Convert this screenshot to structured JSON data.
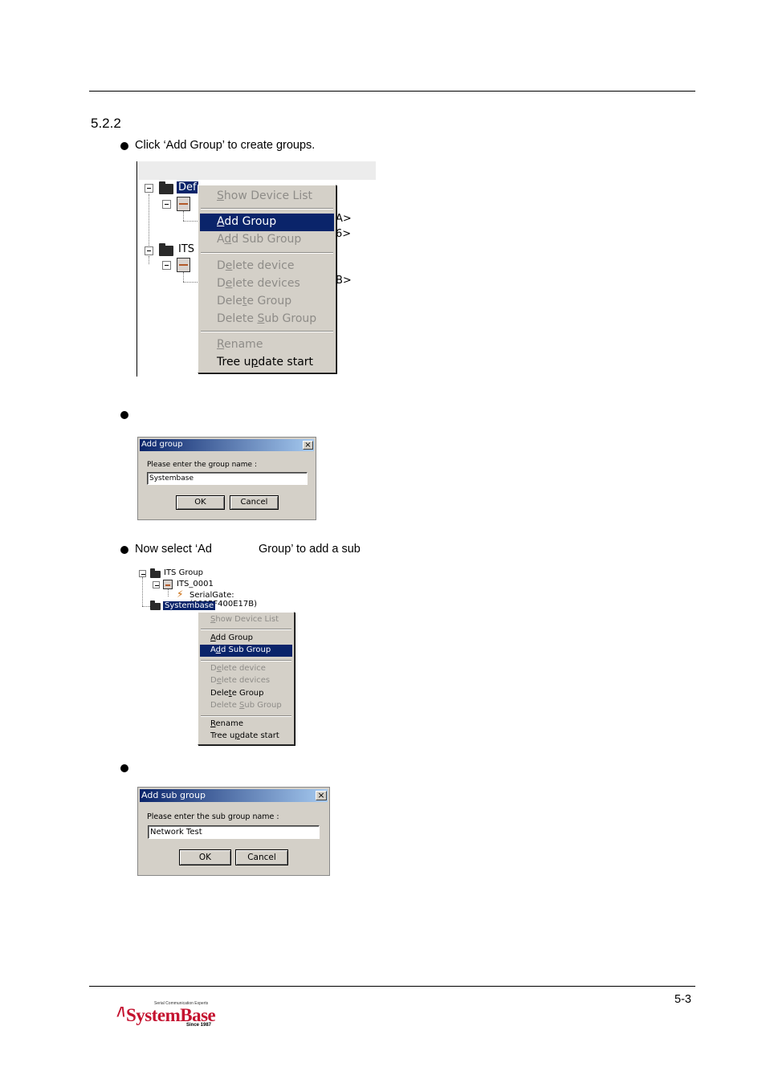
{
  "section": {
    "number": "5.2.2"
  },
  "bullets": {
    "b1": "Click ‘Add Group’ to create groups.",
    "b3_part1": "Now select ‘Ad",
    "b3_part2": "Group’ to add a sub"
  },
  "shot1": {
    "tree": {
      "root1_label": "Def",
      "root2_label": "ITS",
      "suffix1": "A>",
      "suffix2": "6>",
      "suffix3": "B>"
    },
    "menu": {
      "show_device_list": [
        "S",
        "how Device List"
      ],
      "add_group": [
        "A",
        "dd Group"
      ],
      "add_sub_group": [
        "A",
        "d",
        "d Sub Group"
      ],
      "delete_device": [
        "D",
        "e",
        "lete device"
      ],
      "delete_devices": [
        "D",
        "e",
        "lete devices"
      ],
      "delete_group": [
        "Dele",
        "t",
        "e Group"
      ],
      "delete_sub_group": [
        "Delete ",
        "S",
        "ub Group"
      ],
      "rename": [
        "R",
        "ename"
      ],
      "tree_update_start": [
        "Tree u",
        "p",
        "date start"
      ]
    }
  },
  "dialog1": {
    "title": "Add group",
    "close": "×",
    "prompt": "Please enter the group name :",
    "value": "Systembase",
    "ok": "OK",
    "cancel": "Cancel"
  },
  "shot3": {
    "tree": {
      "group_label": "ITS Group",
      "device_label": "ITS_0001",
      "port_label": "SerialGate:(0005F400E17B)",
      "selected_label": "Systembase"
    },
    "menu": {
      "show_device_list": [
        "S",
        "how Device List"
      ],
      "add_group": [
        "A",
        "dd Group"
      ],
      "add_sub_group": [
        "A",
        "d",
        "d Sub Group"
      ],
      "delete_device": [
        "D",
        "e",
        "lete device"
      ],
      "delete_devices": [
        "D",
        "e",
        "lete devices"
      ],
      "delete_group": [
        "Dele",
        "t",
        "e Group"
      ],
      "delete_sub_group": [
        "Delete ",
        "S",
        "ub Group"
      ],
      "rename": [
        "R",
        "ename"
      ],
      "tree_update_start": [
        "Tree u",
        "p",
        "date start"
      ]
    }
  },
  "dialog2": {
    "title": "Add sub group",
    "close": "×",
    "prompt": "Please enter the sub group name :",
    "value": "Network Test",
    "ok": "OK",
    "cancel": "Cancel"
  },
  "footer": {
    "page_number": "5-3",
    "logo_tagline": "Serial Communication Experts",
    "logo_name": "SystemBase",
    "logo_since": "Since 1987"
  },
  "colors": {
    "selection": "#0a246a",
    "dialog_face": "#d4d0c8",
    "brand_red": "#c4122f"
  }
}
